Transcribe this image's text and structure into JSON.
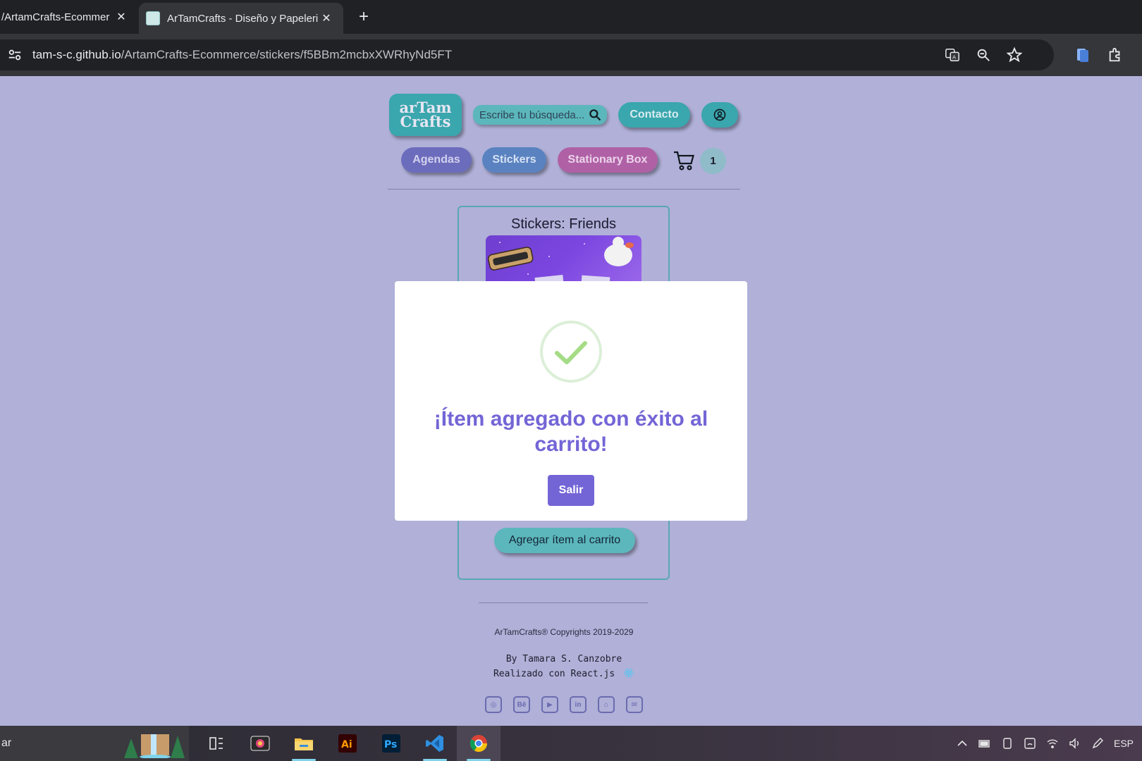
{
  "browser": {
    "tabs": [
      {
        "title": "/ArtamCrafts-Ecommer",
        "active": false
      },
      {
        "title": "ArTamCrafts - Diseño y Papeleri",
        "active": true
      }
    ],
    "address": {
      "host": "tam-s-c.github.io",
      "path": "/ArtamCrafts-Ecommerce/stickers/f5BBm2mcbxXWRhyNd5FT"
    }
  },
  "header": {
    "logo": {
      "line1": "arTam",
      "line2": "Crafts"
    },
    "search_placeholder": "Escribe tu búsqueda...",
    "contact_label": "Contacto",
    "nav": {
      "agendas": "Agendas",
      "stickers": "Stickers",
      "stationary": "Stationary Box"
    },
    "cart_count": "1"
  },
  "product": {
    "title": "Stickers: Friends",
    "add_button": "Agregar ítem al carrito"
  },
  "footer": {
    "copyright": "ArTamCrafts® Copyrights 2019-2029",
    "author": "By Tamara S. Canzobre",
    "built_with": "Realizado con React.js",
    "socials": [
      "instagram-icon",
      "behance-icon",
      "youtube-icon",
      "linkedin-icon",
      "github-icon",
      "mail-icon"
    ],
    "social_glyphs": [
      "◎",
      "Bē",
      "▶",
      "in",
      "⌂",
      "✉"
    ]
  },
  "modal": {
    "message": "¡Ítem agregado con éxito al carrito!",
    "exit_label": "Salir"
  },
  "taskbar": {
    "search_text": "ar",
    "language": "ESP",
    "apps": [
      "task-view-icon",
      "media-app-icon",
      "file-explorer-icon",
      "illustrator-icon",
      "photoshop-icon",
      "vscode-icon",
      "chrome-icon"
    ]
  },
  "colors": {
    "page_bg": "#b0b0d8",
    "teal": "#3aa6ad",
    "modal_accent": "#7365d6",
    "agendas": "#6c6cbd",
    "stickers": "#5a82c0",
    "stationary": "#b061a6"
  }
}
